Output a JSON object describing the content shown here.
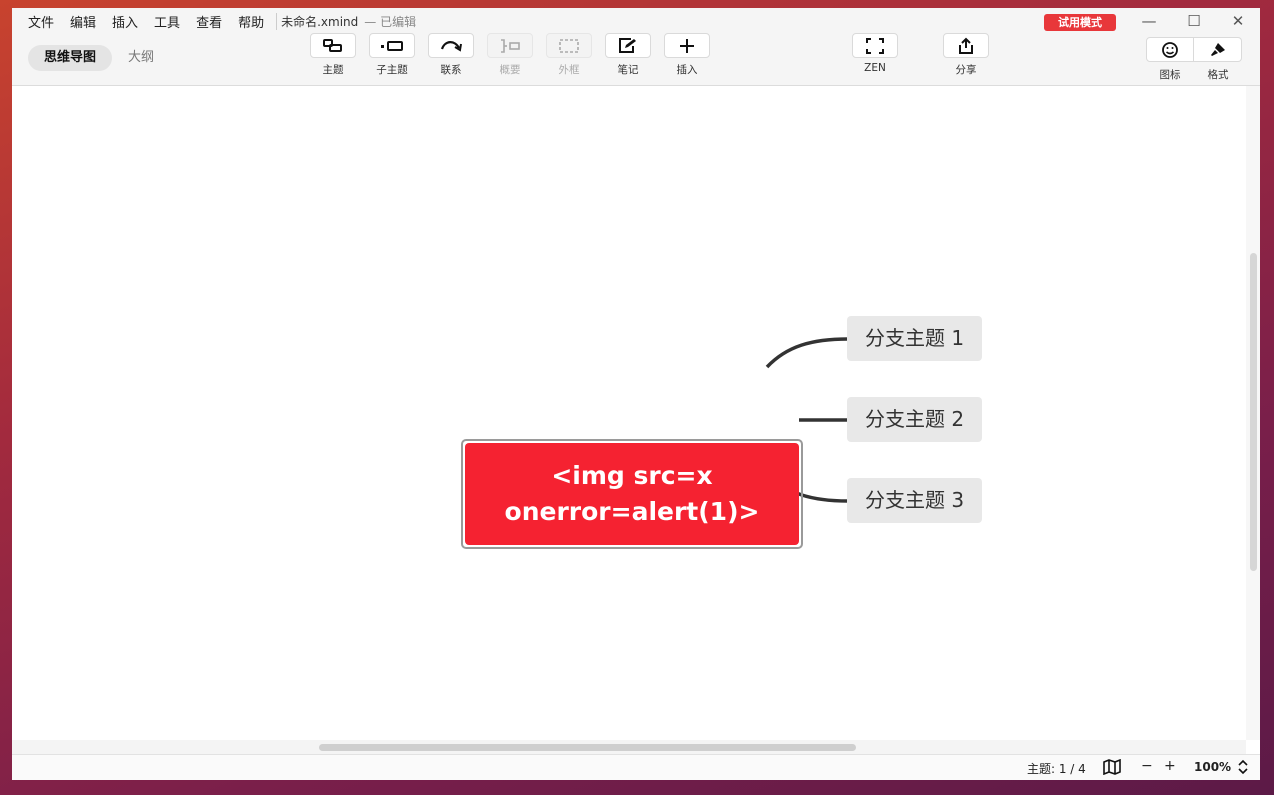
{
  "menubar": {
    "items": [
      "文件",
      "编辑",
      "插入",
      "工具",
      "查看",
      "帮助"
    ],
    "document_title": "未命名.xmind",
    "document_status": "— 已编辑"
  },
  "trial_badge": "试用模式",
  "window_controls": {
    "minimize": "—",
    "maximize": "☐",
    "close": "✕"
  },
  "view_tabs": {
    "mindmap": "思维导图",
    "outline": "大纲"
  },
  "toolbar": {
    "topic": "主题",
    "subtopic": "子主题",
    "relationship": "联系",
    "summary": "概要",
    "boundary": "外框",
    "note": "笔记",
    "insert": "插入",
    "zen": "ZEN",
    "share": "分享"
  },
  "right_panel": {
    "icons": "图标",
    "format": "格式"
  },
  "mindmap": {
    "central_topic": "<img src=x onerror=alert(1)>",
    "branches": [
      "分支主题 1",
      "分支主题 2",
      "分支主题 3"
    ],
    "colors": {
      "central": "#f52231",
      "branch_fill": "#e8e8e8",
      "connector": "#333333"
    }
  },
  "statusbar": {
    "topic_count": "主题: 1 / 4",
    "zoom_out": "−",
    "zoom_in": "+",
    "zoom": "100%"
  }
}
